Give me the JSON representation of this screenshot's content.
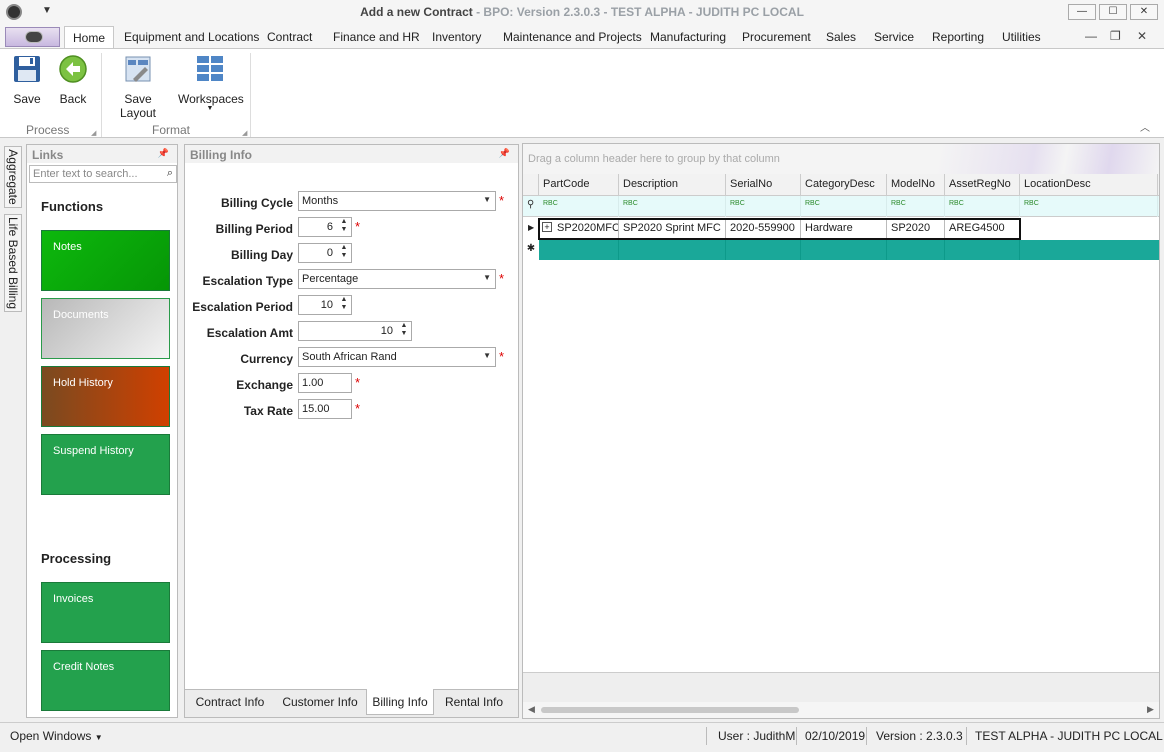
{
  "window": {
    "title_main": "Add a new Contract",
    "title_suffix": " - BPO: Version 2.3.0.3 - TEST ALPHA - JUDITH PC LOCAL",
    "minimize": "—",
    "maximize": "☐",
    "close": "✕"
  },
  "ribbon": {
    "tabs": [
      "Home",
      "Equipment and Locations",
      "Contract",
      "Finance and HR",
      "Inventory",
      "Maintenance and Projects",
      "Manufacturing",
      "Procurement",
      "Sales",
      "Service",
      "Reporting",
      "Utilities"
    ],
    "buttons": {
      "save": "Save",
      "back": "Back",
      "save_layout": "Save Layout",
      "workspaces": "Workspaces"
    },
    "groups": {
      "process": "Process",
      "format": "Format"
    }
  },
  "side_tabs": {
    "aggregate": "Aggregate",
    "life_based_billing": "Life Based Billing"
  },
  "links": {
    "title": "Links",
    "search_placeholder": "Enter text to search...",
    "functions_heading": "Functions",
    "functions": [
      "Notes",
      "Documents",
      "Hold History",
      "Suspend History"
    ],
    "processing_heading": "Processing",
    "processing": [
      "Invoices",
      "Credit Notes"
    ]
  },
  "billing": {
    "title": "Billing Info",
    "fields": {
      "billing_cycle": {
        "label": "Billing Cycle",
        "value": "Months"
      },
      "billing_period": {
        "label": "Billing Period",
        "value": "6"
      },
      "billing_day": {
        "label": "Billing Day",
        "value": "0"
      },
      "escalation_type": {
        "label": "Escalation Type",
        "value": "Percentage"
      },
      "escalation_period": {
        "label": "Escalation Period",
        "value": "10"
      },
      "escalation_amt": {
        "label": "Escalation Amt",
        "value": "10"
      },
      "currency": {
        "label": "Currency",
        "value": "South African Rand"
      },
      "exchange": {
        "label": "Exchange",
        "value": "1.00"
      },
      "tax_rate": {
        "label": "Tax Rate",
        "value": "15.00"
      }
    },
    "required_mark": "*",
    "bottom_tabs": [
      "Contract Info",
      "Customer Info",
      "Billing Info",
      "Rental Info"
    ]
  },
  "grid": {
    "group_hint": "Drag a column header here to group by that column",
    "columns": [
      "PartCode",
      "Description",
      "SerialNo",
      "CategoryDesc",
      "ModelNo",
      "AssetRegNo",
      "LocationDesc"
    ],
    "filter_glyph": "RBC",
    "rows": [
      [
        "SP2020MFC",
        "SP2020 Sprint MFC",
        "2020-559900",
        "Hardware",
        "SP2020",
        "AREG4500",
        ""
      ]
    ],
    "row_indicator": "▶",
    "new_row_indicator": "✱",
    "expand_glyph": "+"
  },
  "statusbar": {
    "open_windows": "Open Windows",
    "user": "User : JudithM",
    "date": "02/10/2019",
    "version": "Version : 2.3.0.3",
    "environment": "TEST ALPHA - JUDITH PC LOCAL"
  },
  "colors": {
    "tile_green": "#23a14d",
    "tile_bright_green": "#0aa20a",
    "tile_hold_from": "#7a4a20",
    "tile_hold_to": "#d04000",
    "new_row": "#1aa899",
    "filter_row": "#e6fafa"
  }
}
